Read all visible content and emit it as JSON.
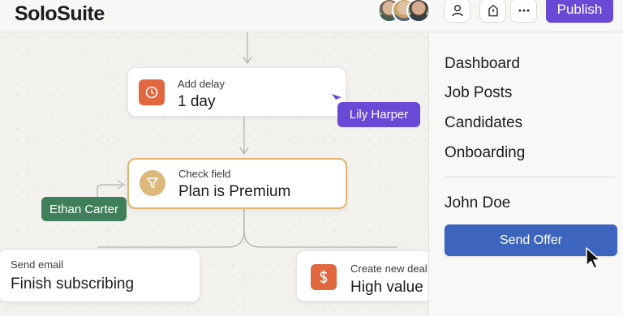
{
  "header": {
    "brand": "SoloSuite",
    "avatars": [
      "avatar-1",
      "avatar-2",
      "avatar-3"
    ],
    "icons": [
      "user-icon",
      "share-icon",
      "more-icon"
    ],
    "publish_label": "Publish"
  },
  "canvas": {
    "nodes": {
      "delay": {
        "sub": "Add delay",
        "main": "1 day",
        "icon": "clock-icon"
      },
      "check": {
        "sub": "Check field",
        "main": "Plan is Premium",
        "icon": "filter-icon"
      },
      "email": {
        "sub": "Send email",
        "main": "Finish subscribing"
      },
      "deal": {
        "sub": "Create new deal",
        "main": "High value customer",
        "icon": "dollar-icon"
      }
    },
    "tags": {
      "lily": "Lily Harper",
      "ethan": "Ethan Carter"
    }
  },
  "sidebar": {
    "items": [
      "Dashboard",
      "Job Posts",
      "Candidates",
      "Onboarding"
    ],
    "user": "John Doe",
    "send_offer_label": "Send Offer"
  },
  "colors": {
    "publish": "#6a49d6",
    "send_offer": "#3e65bd",
    "lily_tag": "#6a49d6",
    "ethan_tag": "#3f7f5a",
    "delay_icon": "#e0673e",
    "check_border": "#e2b66c",
    "deal_icon": "#e0673e"
  }
}
